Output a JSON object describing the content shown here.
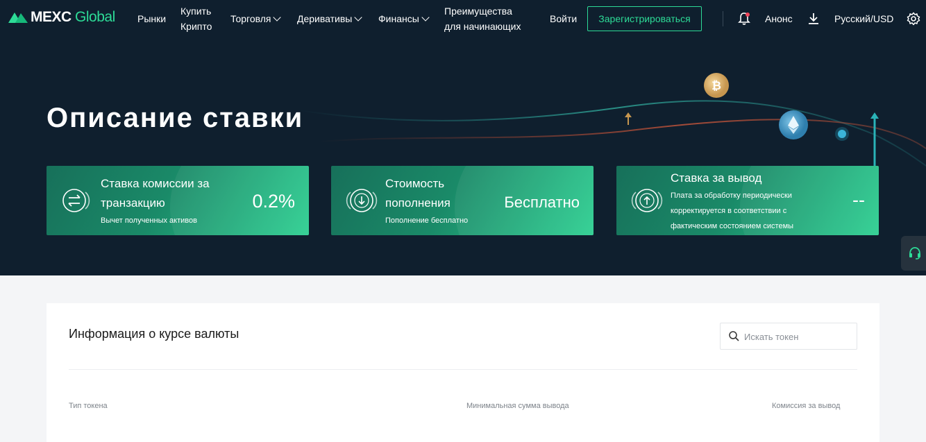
{
  "nav": {
    "logo_main": "MEXC",
    "logo_accent": "Global",
    "items": [
      {
        "label": "Рынки"
      },
      {
        "label_line1": "Купить",
        "label_line2": "Крипто"
      },
      {
        "label": "Торговля"
      },
      {
        "label": "Деривативы"
      },
      {
        "label": "Финансы"
      },
      {
        "label_line1": "Преимущества",
        "label_line2": "для начинающих"
      }
    ],
    "login": "Войти",
    "register": "Зарегистрироваться",
    "announce": "Анонс",
    "lang": "Русский/USD"
  },
  "hero": {
    "title": "Описание ставки",
    "cards": [
      {
        "title_line1": "Ставка комиссии за",
        "title_line2": "транзакцию",
        "sub": "Вычет полученных активов",
        "value": "0.2%"
      },
      {
        "title_line1": "Стоимость",
        "title_line2": "пополнения",
        "sub": "Пополнение бесплатно",
        "value": "Бесплатно"
      },
      {
        "title": "Ставка за вывод",
        "sub_line1": "Плата за обработку периодически",
        "sub_line2": "корректируется в соответствии с",
        "sub_line3": "фактическим состоянием системы",
        "value": "--"
      }
    ]
  },
  "content": {
    "title": "Информация о курсе валюты",
    "search_placeholder": "Искать токен",
    "columns": [
      "Тип токена",
      "Минимальная сумма вывода",
      "Комиссия за вывод"
    ]
  },
  "colors": {
    "accent": "#2ddb97",
    "nav_bg": "#0f1f2e"
  },
  "icons": [
    "bell-icon",
    "download-icon",
    "gear-icon",
    "search-icon",
    "support-headset-icon",
    "bitcoin-coin-icon",
    "ethereum-coin-icon"
  ]
}
